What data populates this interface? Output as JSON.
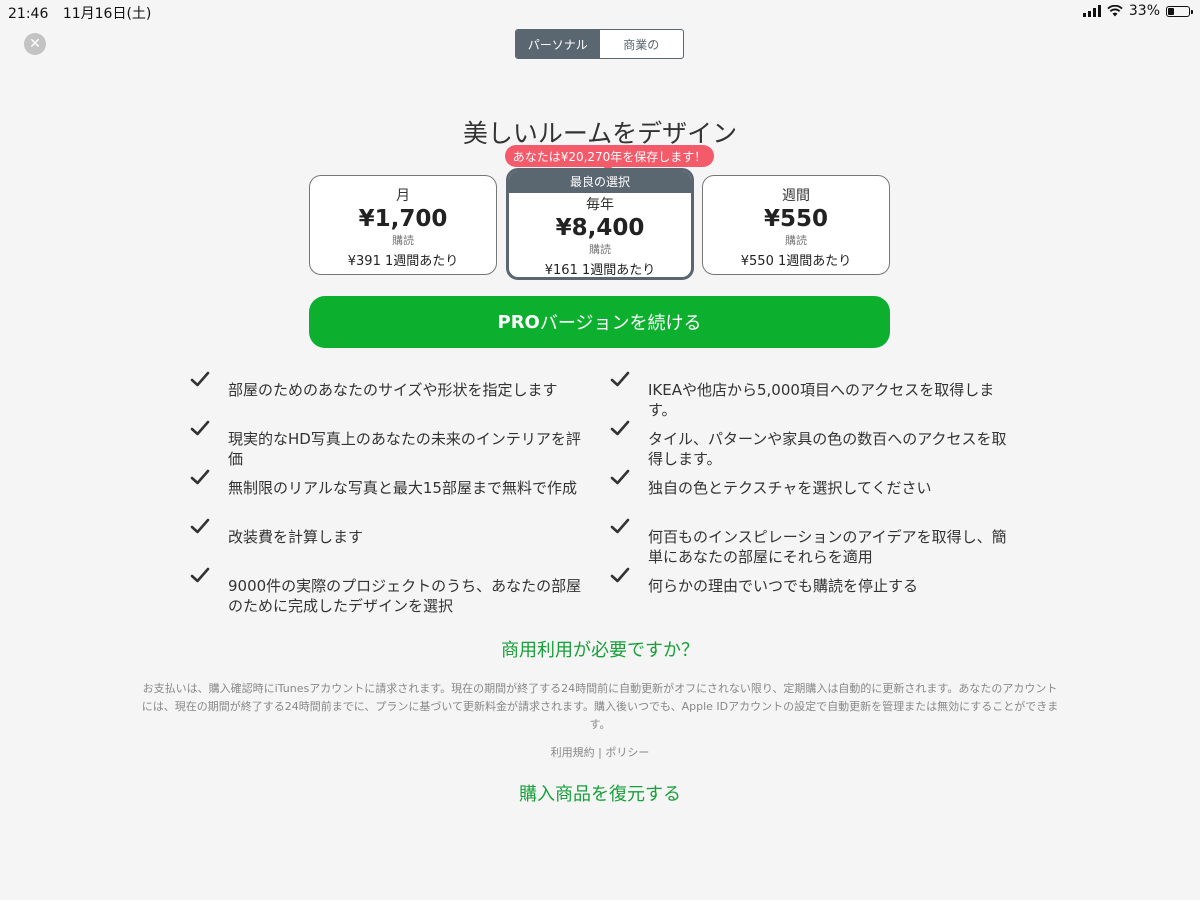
{
  "status_bar": {
    "time": "21:46",
    "date": "11月16日(土)",
    "battery": "33%",
    "battery_level": 0.33
  },
  "segmented": {
    "personal": "パーソナル",
    "business": "商業の"
  },
  "title": "美しいルームをデザイン",
  "save_badge": "あなたは¥20,270年を保存します！",
  "plans": [
    {
      "name": "月",
      "price": "¥1,700",
      "sub": "購読",
      "weekly": "¥391 1週間あたり"
    },
    {
      "best": "最良の選択",
      "name": "毎年",
      "price": "¥8,400",
      "sub": "購読",
      "weekly": "¥161 1週間あたり"
    },
    {
      "name": "週間",
      "price": "¥550",
      "sub": "購読",
      "weekly": "¥550 1週間あたり"
    }
  ],
  "cta": {
    "bold": "PRO",
    "rest": "バージョンを続ける"
  },
  "features_left": [
    "部屋のためのあなたのサイズや形状を指定します",
    "現実的なHD写真上のあなたの未来のインテリアを評価",
    "無制限のリアルな写真と最大15部屋まで無料で作成",
    "改装費を計算します",
    "9000件の実際のプロジェクトのうち、あなたの部屋のために完成したデザインを選択"
  ],
  "features_right": [
    "IKEAや他店から5,000項目へのアクセスを取得します。",
    "タイル、パターンや家具の色の数百へのアクセスを取得します。",
    "独自の色とテクスチャを選択してください",
    "何百ものインスピレーションのアイデアを取得し、簡単にあなたの部屋にそれらを適用",
    "何らかの理由でいつでも購読を停止する"
  ],
  "commercial_link": "商用利用が必要ですか？",
  "fineprint": "お支払いは、購入確認時にiTunesアカウントに請求されます。現在の期間が終了する24時間前に自動更新がオフにされない限り、定期購入は自動的に更新されます。あなたのアカウントには、現在の期間が終了する24時間前までに、プランに基づいて更新料金が請求されます。購入後いつでも、Apple IDアカウントの設定で自動更新を管理または無効にすることができます。",
  "terms": "利用規約 | ポリシー",
  "restore": "購入商品を復元する",
  "colors": {
    "accent_green": "#0cb02e",
    "link_green": "#18a03a",
    "badge_red": "#f35a6a",
    "slate": "#5a6670"
  }
}
